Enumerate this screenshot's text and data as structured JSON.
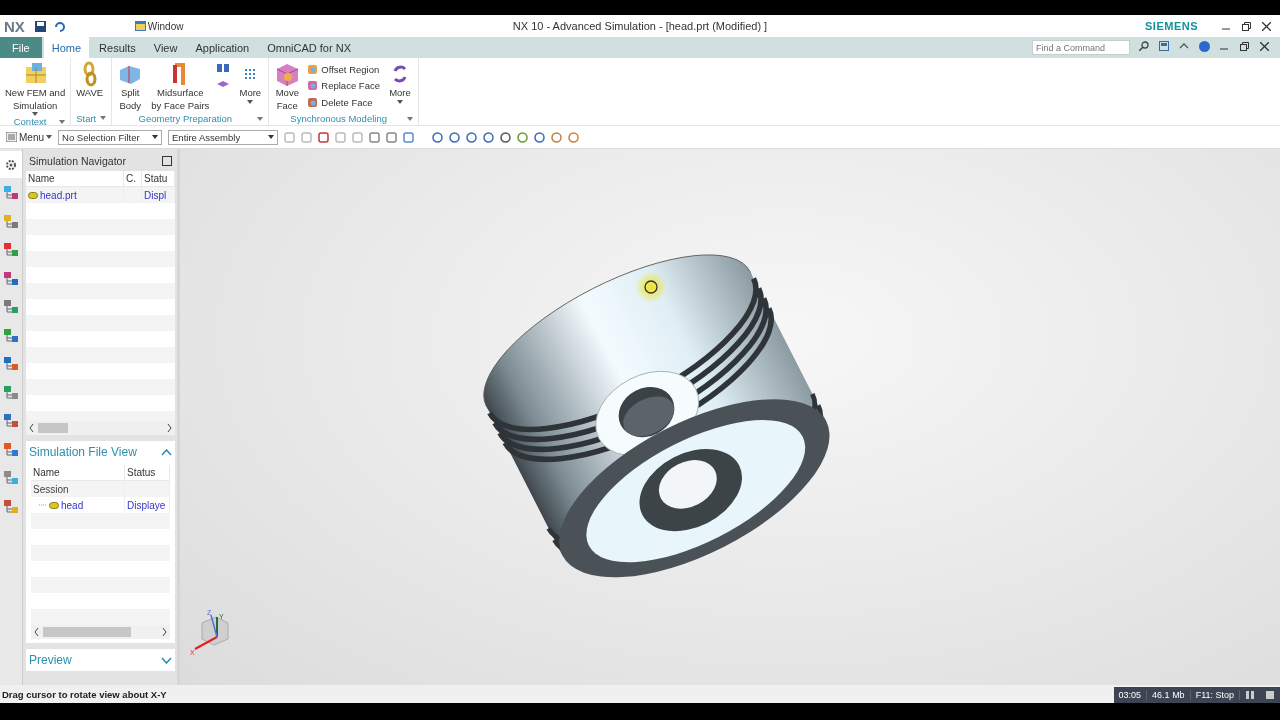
{
  "quick_access": {
    "logo": "NX",
    "window_menu": "Window"
  },
  "window": {
    "title": "NX 10 - Advanced Simulation - [head.prt (Modified) ]",
    "brand": "SIEMENS"
  },
  "menu_tabs": [
    {
      "label": "File",
      "kind": "file",
      "selected": false
    },
    {
      "label": "Home",
      "kind": "tab",
      "selected": true
    },
    {
      "label": "Results",
      "kind": "tab",
      "selected": false
    },
    {
      "label": "View",
      "kind": "tab",
      "selected": false
    },
    {
      "label": "Application",
      "kind": "tab",
      "selected": false
    },
    {
      "label": "OmniCAD for NX",
      "kind": "tab",
      "selected": false
    }
  ],
  "command_search": {
    "placeholder": "Find a Command"
  },
  "ribbon_groups": [
    {
      "label": "Context",
      "items": [
        {
          "kind": "large",
          "lines": [
            "New FEM and",
            "Simulation"
          ],
          "dropdown": true
        }
      ]
    },
    {
      "label": "Start",
      "items": [
        {
          "kind": "large",
          "lines": [
            "WAVE"
          ],
          "dropdown": false
        }
      ]
    },
    {
      "label": "Geometry Preparation",
      "items": [
        {
          "kind": "large",
          "lines": [
            "Split",
            "Body"
          ],
          "dropdown": false
        },
        {
          "kind": "large",
          "lines": [
            "Midsurface",
            "by Face Pairs"
          ],
          "dropdown": false
        },
        {
          "kind": "icons"
        },
        {
          "kind": "large",
          "lines": [
            "More"
          ],
          "dropdown": true
        }
      ]
    },
    {
      "label": "Synchronous Modeling",
      "items": [
        {
          "kind": "large",
          "lines": [
            "Move",
            "Face"
          ],
          "dropdown": false
        },
        {
          "kind": "stack",
          "lines": [
            "Offset Region",
            "Replace Face",
            "Delete Face"
          ]
        },
        {
          "kind": "large",
          "lines": [
            "More"
          ],
          "dropdown": true
        }
      ]
    }
  ],
  "toolbar": {
    "menu": "Menu",
    "selection_filter": "No Selection Filter",
    "scope": "Entire Assembly"
  },
  "resource_tabs": [
    {
      "selected": true
    },
    {
      "selected": false
    },
    {
      "selected": false
    },
    {
      "selected": false
    },
    {
      "selected": false
    },
    {
      "selected": false
    },
    {
      "selected": false
    },
    {
      "selected": false
    },
    {
      "selected": false
    },
    {
      "selected": false
    },
    {
      "selected": false
    },
    {
      "selected": false
    },
    {
      "selected": false
    }
  ],
  "navigator": {
    "title": "Simulation Navigator",
    "columns": [
      "Name",
      "C.",
      "Statu"
    ],
    "rows": [
      {
        "name": "head.prt",
        "status": "Displ"
      }
    ]
  },
  "file_view": {
    "title": "Simulation File View",
    "expanded": true,
    "columns": [
      "Name",
      "Status"
    ],
    "rows": [
      {
        "name": "Session",
        "status": "",
        "children": [
          {
            "name": "head",
            "status": "Displaye"
          }
        ]
      }
    ]
  },
  "preview": {
    "title": "Preview",
    "expanded": false
  },
  "triad": {
    "x": "X",
    "y": "Y",
    "z": "Z"
  },
  "status_bar": {
    "message": "Drag cursor to rotate view about X-Y"
  },
  "recorder": [
    "03:05",
    "46.1 Mb",
    "F11: Stop"
  ]
}
